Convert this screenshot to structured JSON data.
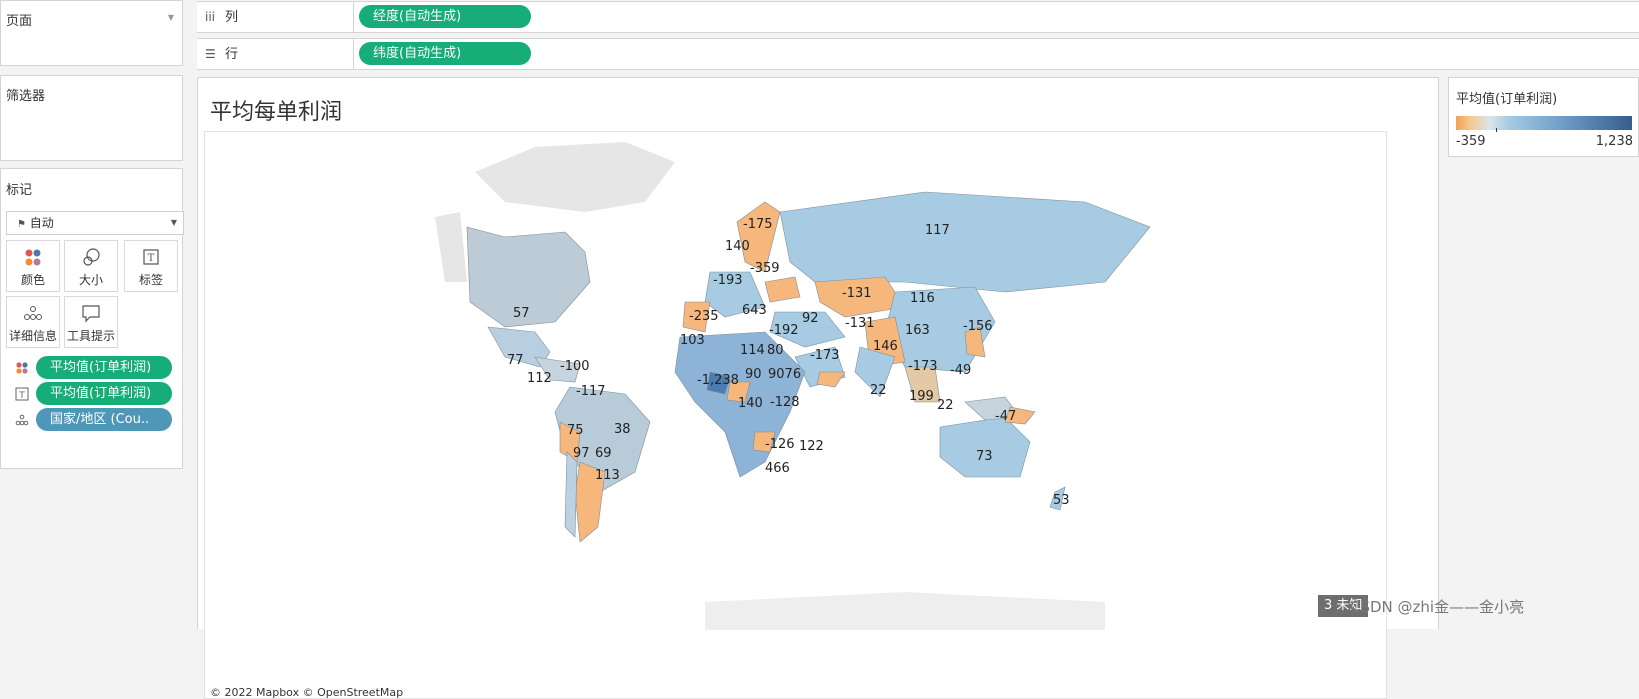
{
  "pages_panel": {
    "title": "页面"
  },
  "filters_panel": {
    "title": "筛选器"
  },
  "marks_panel": {
    "title": "标记",
    "mark_type": "自动",
    "buttons": {
      "color": "颜色",
      "size": "大小",
      "label": "标签",
      "detail": "详细信息",
      "tooltip": "工具提示"
    },
    "pills": [
      {
        "text": "平均值(订单利润)",
        "encoding": "color"
      },
      {
        "text": "平均值(订单利润)",
        "encoding": "label"
      },
      {
        "text": "国家/地区 (Cou..",
        "encoding": "detail"
      }
    ]
  },
  "shelves": {
    "columns": {
      "label": "列",
      "pill": "经度(自动生成)"
    },
    "rows": {
      "label": "行",
      "pill": "纬度(自动生成)"
    }
  },
  "viz": {
    "title": "平均每单利润",
    "attribution": "© 2022 Mapbox © OpenStreetMap",
    "labels": [
      "117",
      "-175",
      "140",
      "-359",
      "-193",
      "57",
      "-131",
      "116",
      "-235",
      "643",
      "92",
      "-192",
      "-131",
      "163",
      "-156",
      "103",
      "146",
      "114",
      "80",
      "-173",
      "-173",
      "77",
      "-100",
      "-49",
      "112",
      "-1,238",
      "9076",
      "90",
      "-117",
      "22",
      "199",
      "22",
      "-47",
      "140",
      "-128",
      "38",
      "75",
      "-126",
      "122",
      "97",
      "69",
      "466",
      "73",
      "113",
      "53"
    ]
  },
  "legend": {
    "title": "平均值(订单利润)",
    "min": "-359",
    "max": "1,238"
  },
  "colors": {
    "low": "#f4a251",
    "mid": "#a6cbe2",
    "high": "#355d8e",
    "pill_green": "#16ad79",
    "pill_blue": "#4e97b9"
  },
  "watermark": {
    "badge": "3 未知",
    "text": "CSDN @zhi金——金小亮"
  }
}
